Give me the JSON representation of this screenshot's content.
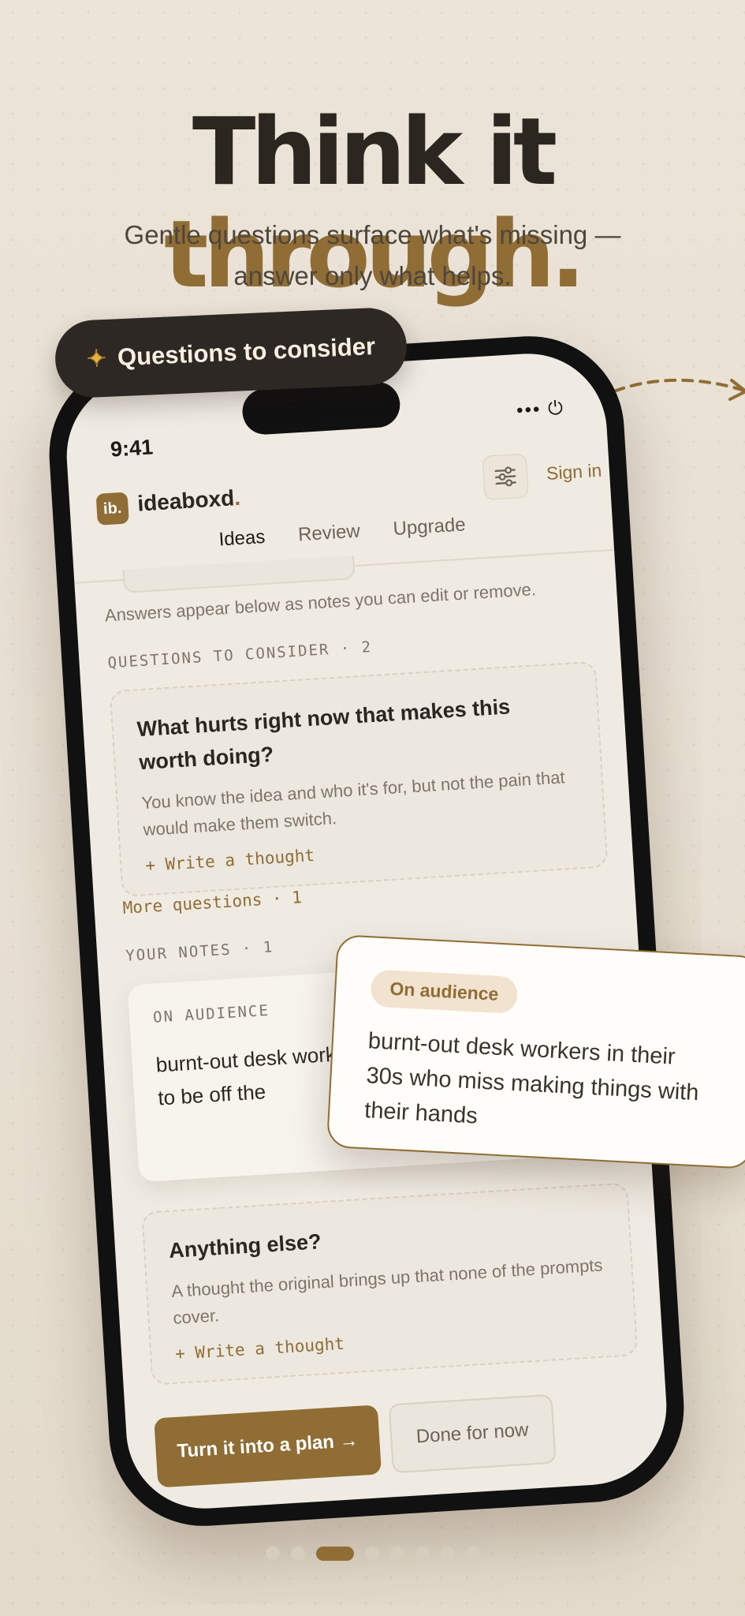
{
  "hero": {
    "headline_part1": "Think it",
    "headline_part2": "through.",
    "subtitle": "Gentle questions surface what's missing — answer only what helps."
  },
  "floating_pill": {
    "icon": "sparkles",
    "label": "Questions to consider"
  },
  "status_bar": {
    "time": "9:41"
  },
  "app": {
    "logo_badge": "ib.",
    "name": "ideaboxd",
    "name_dot": ".",
    "sign_in": "Sign in",
    "tabs": [
      {
        "label": "Ideas",
        "active": true
      },
      {
        "label": "Review",
        "active": false
      },
      {
        "label": "Upgrade",
        "active": false
      }
    ],
    "hint": "Answers appear below as notes you can edit or remove.",
    "questions_section_label": "QUESTIONS TO CONSIDER · 2",
    "question_card": {
      "title": "What hurts right now that makes this worth doing?",
      "description": "You know the idea and who it's for, but not the pain that would make them switch.",
      "action": "+ Write a thought"
    },
    "more_questions": "More questions · 1",
    "notes_section_label": "YOUR NOTES · 1",
    "note_card": {
      "label": "ON AUDIENCE",
      "visible_text": "burnt-out desk work making things with t excuse to be off the"
    },
    "anything_else_card": {
      "title": "Anything else?",
      "description": "A thought the original brings up that none of the prompts cover.",
      "action": "+ Write a thought"
    },
    "primary_button": "Turn it into a plan →",
    "secondary_button": "Done for now"
  },
  "floating_note": {
    "tag": "On audience",
    "body": "burnt-out desk workers in their 30s who miss making things with their hands"
  },
  "pager": {
    "count": 8,
    "active_index": 2
  },
  "colors": {
    "accent": "#8f6d34",
    "dark": "#2b2620",
    "background": "#ebe4d8"
  }
}
